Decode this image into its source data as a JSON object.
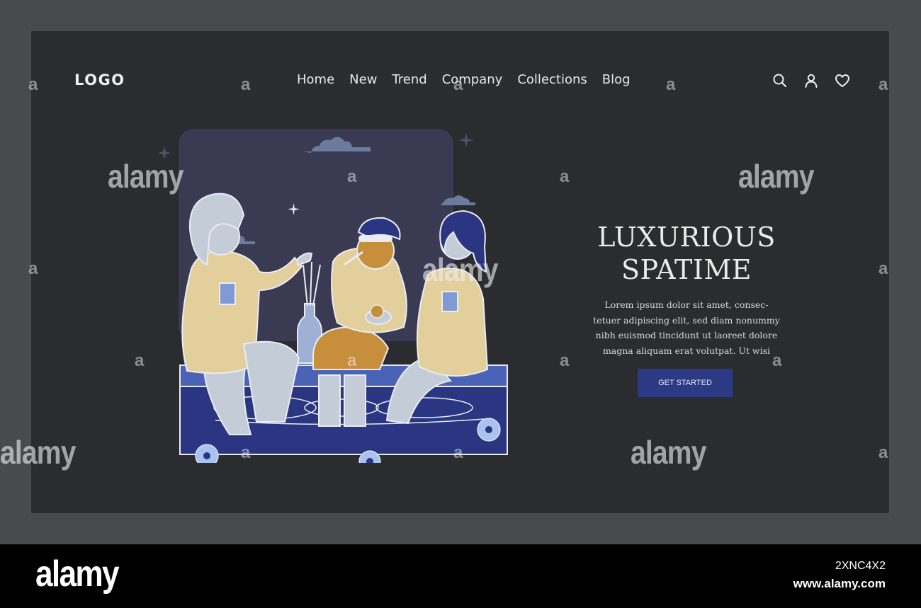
{
  "header": {
    "logo": "LOGO",
    "nav": [
      "Home",
      "New",
      "Trend",
      "Company",
      "Collections",
      "Blog"
    ],
    "icons": [
      "search-icon",
      "user-icon",
      "heart-icon"
    ]
  },
  "hero": {
    "title_line1": "LUXURIOUS",
    "title_line2": "SPATIME",
    "body_line1": "Lorem ipsum dolor sit amet, consec-",
    "body_line2": "tetuer adipiscing elit, sed diam nonummy",
    "body_line3": "nibh euismod tincidunt ut laoreet dolore",
    "body_line4": "magna aliquam erat volutpat. Ut wisi",
    "cta": "GET STARTED"
  },
  "watermark": {
    "brand": "alamy",
    "mark": "a",
    "image_id": "2XNC4X2",
    "url": "www.alamy.com"
  },
  "colors": {
    "outer_bg": "#474b4b",
    "frame_bg": "#2b2c30",
    "accent": "#2c3a86",
    "robe": "#e3cf9b",
    "water": "#2a3682",
    "night_sky": "#3a3b52"
  }
}
